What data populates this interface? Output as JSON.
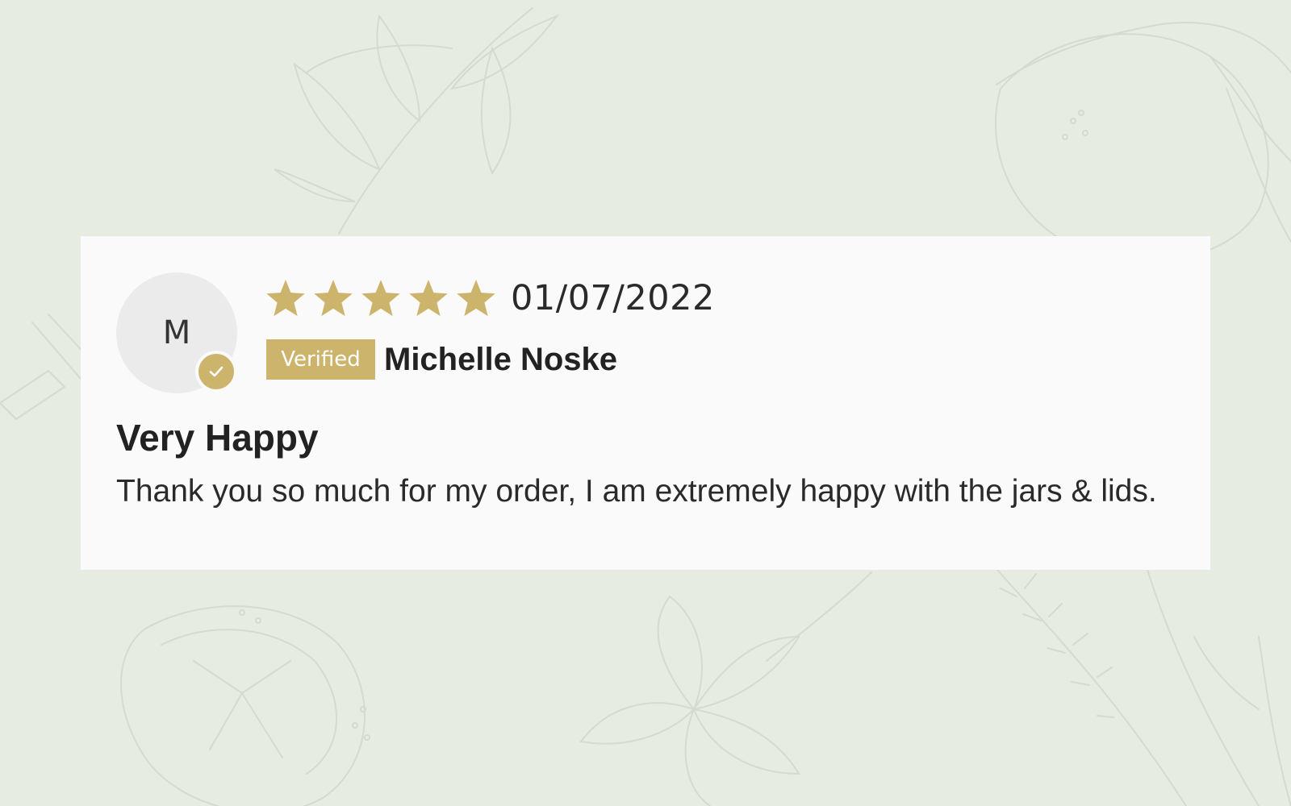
{
  "colors": {
    "background": "#e6ece2",
    "card": "#fafafa",
    "accent_gold": "#cdb46c",
    "avatar_bg": "#ebebeb",
    "text": "#2a2a2a"
  },
  "review": {
    "avatar_initial": "M",
    "rating": 5,
    "rating_max": 5,
    "date": "01/07/2022",
    "verified_label": "Verified",
    "reviewer_name": "Michelle Noske",
    "title": "Very Happy",
    "body": "Thank you so much for my order, I am extremely happy with the jars & lids."
  },
  "icons": {
    "star": "star-icon",
    "verified_check": "checkmark-icon",
    "background": "botanical-line-art"
  }
}
